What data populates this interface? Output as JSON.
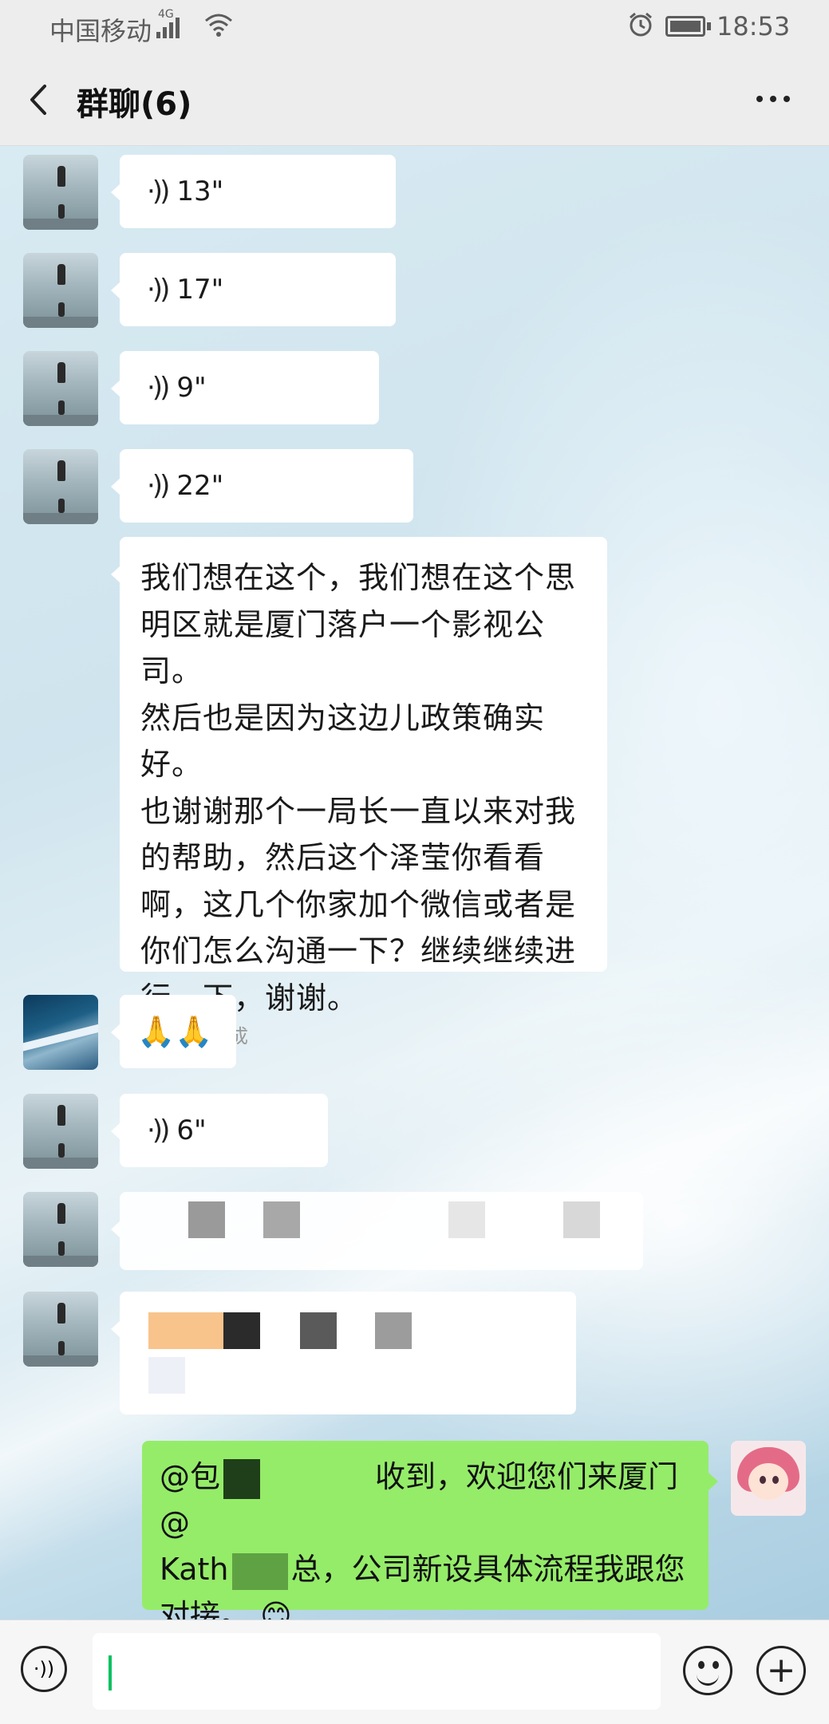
{
  "status_bar": {
    "carrier": "中国移动",
    "network": "4G",
    "time": "18:53"
  },
  "header": {
    "title": "群聊(6)"
  },
  "messages": [
    {
      "type": "voice",
      "duration": "13\""
    },
    {
      "type": "voice",
      "duration": "17\""
    },
    {
      "type": "voice",
      "duration": "9\""
    },
    {
      "type": "voice",
      "duration": "22\""
    },
    {
      "type": "transcript",
      "lines": [
        "我们想在这个，我们想在这个思",
        "明区就是厦门落户一个影视公司。",
        "然后也是因为这边儿政策确实好。",
        "也谢谢那个一局长一直以来对我",
        "的帮助，然后这个泽莹你看看",
        "啊，这几个你家加个微信或者是",
        "你们怎么沟通一下？继续继续进",
        "行一下，谢谢。"
      ],
      "status": "转换完成"
    },
    {
      "type": "emoji",
      "text": "🙏🙏"
    },
    {
      "type": "voice",
      "duration": "6\""
    }
  ],
  "my_message": {
    "part1": "@包",
    "part2": "收到，欢迎您们来厦门@",
    "part3": "Kath",
    "part4": "总，公司新设具体流程我跟您",
    "part5": "对接。",
    "emoji": "😊"
  },
  "icons": {
    "back": "back-arrow-icon",
    "more": "more-dots-icon",
    "voice": "voice-wave-icon",
    "emoji": "emoji-face-icon",
    "plus": "plus-circle-icon"
  }
}
